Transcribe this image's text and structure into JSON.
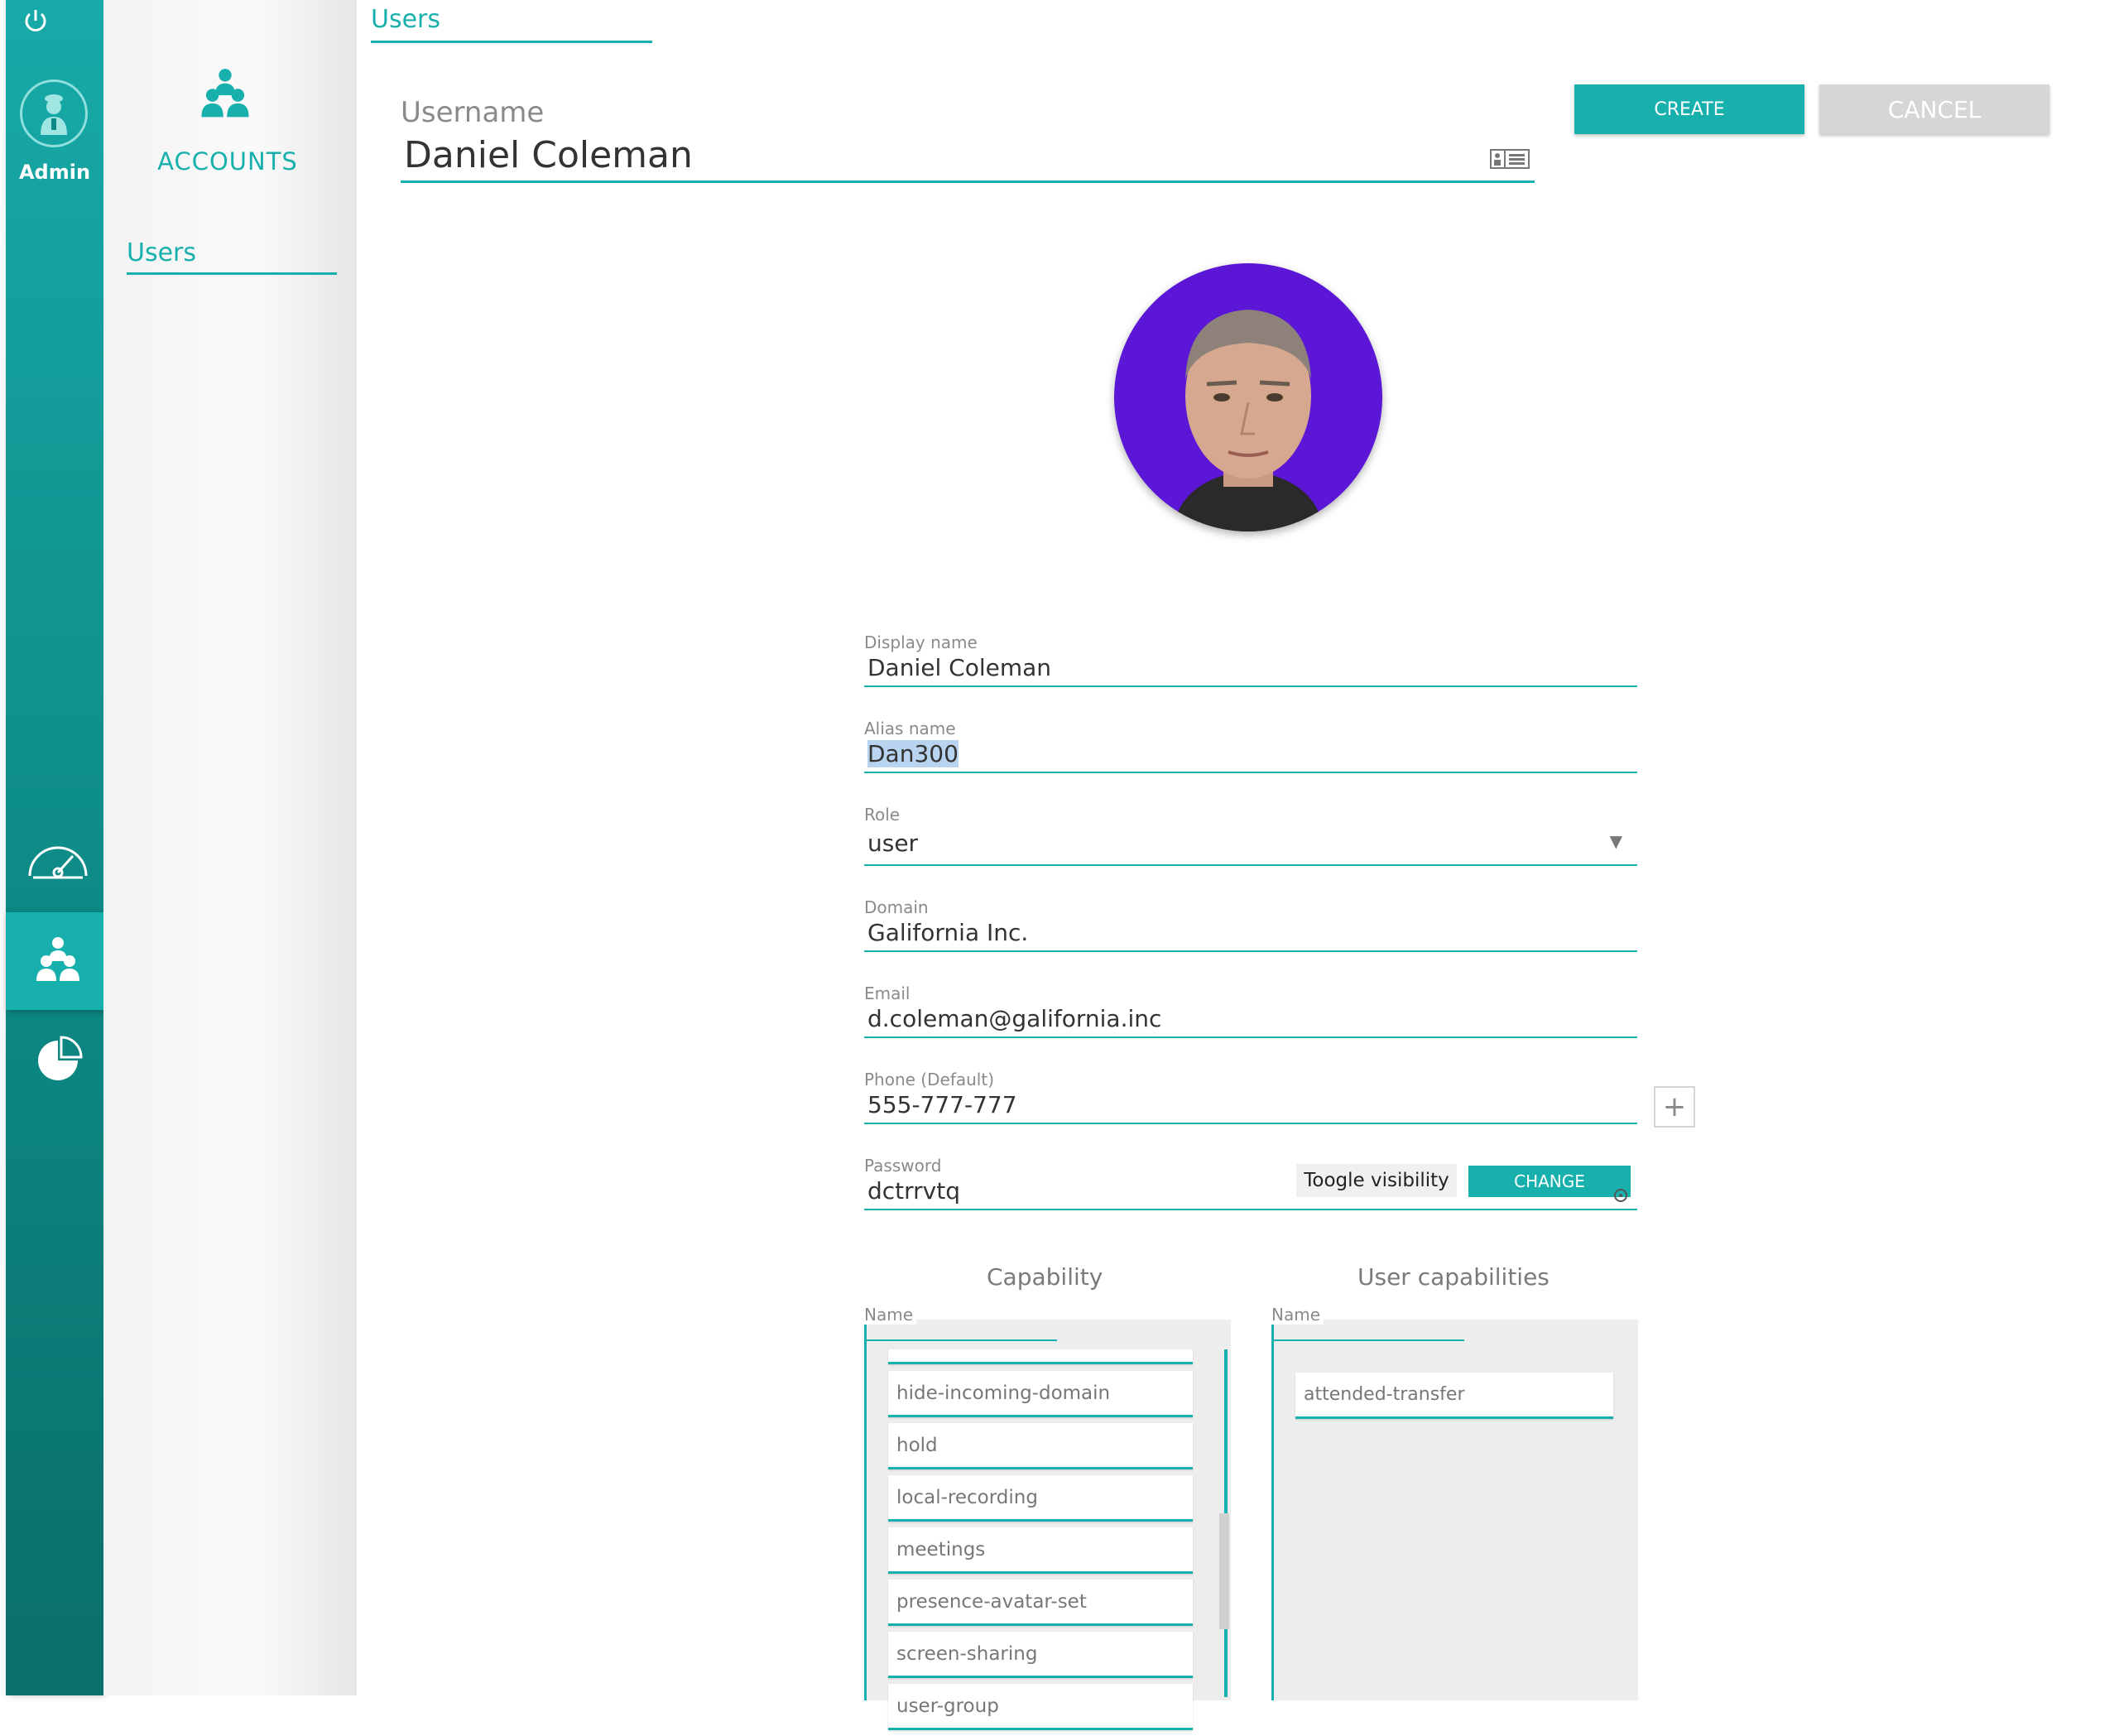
{
  "rail": {
    "admin_label": "Admin",
    "icons": [
      "power-icon",
      "admin-user-icon",
      "gauge-icon",
      "accounts-icon",
      "pie-chart-icon"
    ]
  },
  "panel": {
    "title": "ACCOUNTS",
    "users_link": "Users"
  },
  "breadcrumb": {
    "label": "Users"
  },
  "header": {
    "username_label": "Username",
    "username_value": "Daniel Coleman",
    "create_label": "CREATE",
    "cancel_label": "CANCEL"
  },
  "form": {
    "display_name": {
      "label": "Display name",
      "value": "Daniel Coleman"
    },
    "alias_name": {
      "label": "Alias name",
      "value": "Dan300"
    },
    "role": {
      "label": "Role",
      "value": "user"
    },
    "domain": {
      "label": "Domain",
      "value": "Galifornia Inc."
    },
    "email": {
      "label": "Email",
      "value": "d.coleman@galifornia.inc"
    },
    "phone": {
      "label": "Phone (Default)",
      "value": "555-777-777",
      "add_label": "+"
    },
    "password": {
      "label": "Password",
      "value": "dctrrvtq",
      "toggle_label": "Toogle visibility",
      "change_label": "CHANGE"
    }
  },
  "capabilities": {
    "title": "Capability",
    "column": "Name",
    "items": [
      "hide-incoming-domain",
      "hold",
      "local-recording",
      "meetings",
      "presence-avatar-set",
      "screen-sharing",
      "user-group"
    ]
  },
  "user_capabilities": {
    "title": "User capabilities",
    "column": "Name",
    "items": [
      "attended-transfer"
    ]
  },
  "colors": {
    "accent": "#17b0ad",
    "avatar_bg": "#5b16d6"
  }
}
